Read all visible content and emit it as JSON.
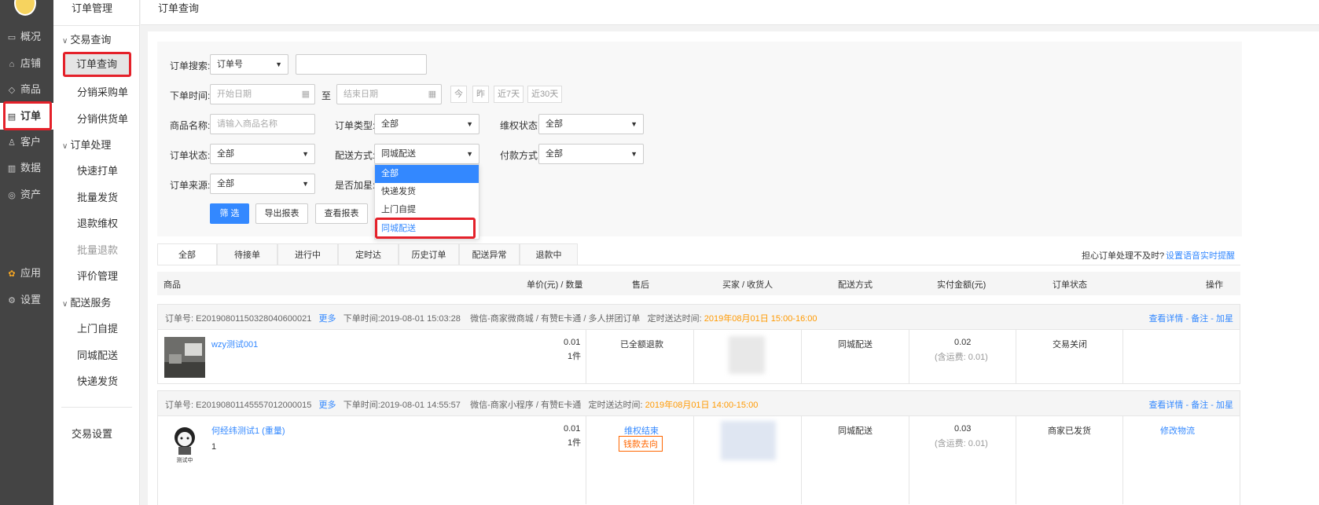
{
  "nav1": {
    "items": [
      {
        "label": "概况",
        "icon": "monitor-icon"
      },
      {
        "label": "店铺",
        "icon": "store-icon"
      },
      {
        "label": "商品",
        "icon": "tag-icon"
      },
      {
        "label": "订单",
        "icon": "order-icon"
      },
      {
        "label": "客户",
        "icon": "user-icon"
      },
      {
        "label": "数据",
        "icon": "chart-icon"
      },
      {
        "label": "资产",
        "icon": "coin-icon"
      },
      {
        "label": "应用",
        "icon": "apps-icon"
      },
      {
        "label": "设置",
        "icon": "gear-icon"
      }
    ]
  },
  "nav2": {
    "title": "订单管理",
    "group1": "交易查询",
    "g1_items": [
      "订单查询",
      "分销采购单",
      "分销供货单"
    ],
    "group2": "订单处理",
    "g2_items": [
      "快速打单",
      "批量发货",
      "退款维权",
      "批量退款",
      "评价管理"
    ],
    "group3": "配送服务",
    "g3_items": [
      "上门自提",
      "同城配送",
      "快递发货"
    ],
    "bottom": "交易设置"
  },
  "header": {
    "crumb": "订单查询"
  },
  "filter": {
    "search_label": "订单搜索:",
    "search_type": "订单号",
    "time_label": "下单时间:",
    "start_ph": "开始日期",
    "to": "至",
    "end_ph": "结束日期",
    "chips": [
      "今",
      "昨",
      "近7天",
      "近30天"
    ],
    "goods_label": "商品名称:",
    "goods_ph": "请输入商品名称",
    "type_label": "订单类型:",
    "type_val": "全部",
    "right_label": "维权状态:",
    "right_val": "全部",
    "status_label": "订单状态:",
    "status_val": "全部",
    "ship_label": "配送方式:",
    "ship_val": "同城配送",
    "pay_label": "付款方式:",
    "pay_val": "全部",
    "source_label": "订单来源:",
    "source_val": "全部",
    "star_label": "是否加星:",
    "btn_filter": "筛 选",
    "btn_export": "导出报表",
    "btn_report": "查看报表",
    "dropdown": [
      "全部",
      "快递发货",
      "上门自提",
      "同城配送"
    ]
  },
  "tabs": [
    "全部",
    "待接单",
    "进行中",
    "定时达",
    "历史订单",
    "配送异常",
    "退款中"
  ],
  "remind": {
    "text": "担心订单处理不及时?",
    "link": "设置语音实时提醒"
  },
  "table": {
    "headers": [
      "商品",
      "单价(元) / 数量",
      "售后",
      "买家 / 收货人",
      "配送方式",
      "实付金额(元)",
      "订单状态",
      "操作"
    ]
  },
  "orders": [
    {
      "no_label": "订单号:",
      "no": "E20190801150328040600021",
      "more": "更多",
      "time": "下单时间:2019-08-01 15:03:28",
      "source": "微信-商家微商城 / 有赞E卡通 / 多人拼团订单",
      "due_label": "定时送达时间:",
      "due": "2019年08月01日 15:00-16:00",
      "actions": "查看详情 - 备注 - 加星",
      "goods": "wzy测试001",
      "price": "0.01",
      "qty": "1件",
      "after": "已全额退款",
      "ship": "同城配送",
      "paid": "0.02",
      "fee": "(含运费: 0.01)",
      "status": "交易关闭"
    },
    {
      "no_label": "订单号:",
      "no": "E20190801145557012000015",
      "more": "更多",
      "time": "下单时间:2019-08-01 14:55:57",
      "source": "微信-商家小程序 / 有赞E卡通",
      "due_label": "定时送达时间:",
      "due": "2019年08月01日 14:00-15:00",
      "actions": "查看详情 - 备注 - 加星",
      "goods": "何经纬测试1 (重量)",
      "sub": "1",
      "thumb_text": "测试中",
      "price": "0.01",
      "qty": "1件",
      "after": "维权结束",
      "after_badge": "钱款去向",
      "ship": "同城配送",
      "paid": "0.03",
      "fee": "(含运费: 0.01)",
      "status": "商家已发货",
      "op": "修改物流"
    }
  ],
  "colors": {
    "accent": "#3388ff",
    "highlight": "#e4212a",
    "orange": "#ff9900"
  }
}
